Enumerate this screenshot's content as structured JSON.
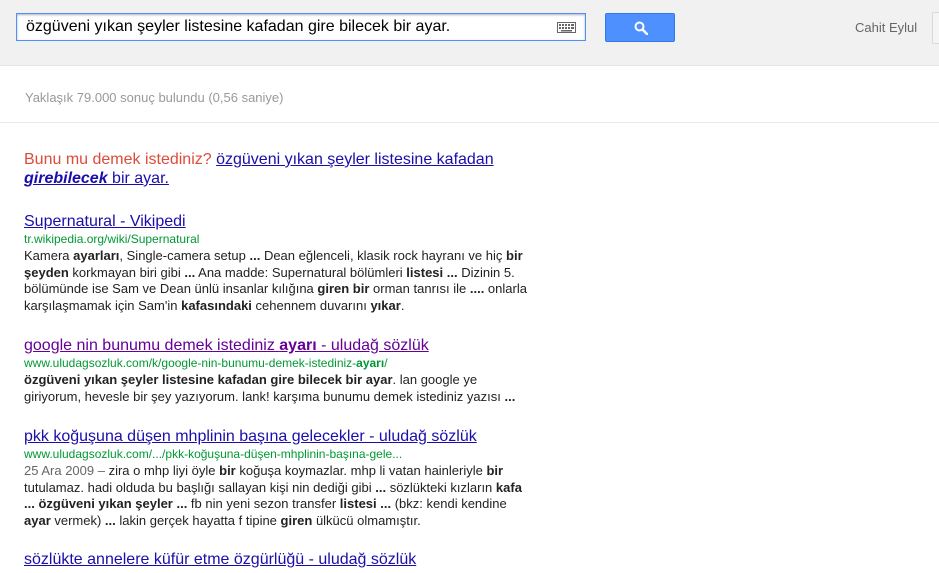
{
  "search": {
    "query": "özgüveni yıkan şeyler listesine kafadan gire bilecek bir ayar."
  },
  "header": {
    "user_name": "Cahit Eylul"
  },
  "stats": {
    "text": "Yaklaşık 79.000 sonuç bulundu (0,56 saniye)"
  },
  "spell": {
    "label": "Bunu mu demek istediniz?",
    "suggestion_parts": [
      {
        "t": "özgüveni yıkan şeyler listesine kafadan ",
        "em": false
      },
      {
        "t": "girebilecek",
        "em": true
      },
      {
        "t": " bir ayar.",
        "em": false
      }
    ]
  },
  "results": [
    {
      "title_parts": [
        {
          "t": "Supernatural - Vikipedi",
          "b": false
        }
      ],
      "visited": false,
      "url_parts": [
        {
          "t": "tr.wikipedia.org/wiki/Supernatural",
          "b": false
        }
      ],
      "date": "",
      "snippet_parts": [
        {
          "t": "Kamera ",
          "b": false
        },
        {
          "t": "ayarları",
          "b": true
        },
        {
          "t": ", Single-camera setup ",
          "b": false
        },
        {
          "t": "...",
          "b": true
        },
        {
          "t": " Dean eğlenceli, klasik rock hayranı ve hiç ",
          "b": false
        },
        {
          "t": "bir şeyden",
          "b": true
        },
        {
          "t": " korkmayan biri gibi ",
          "b": false
        },
        {
          "t": "...",
          "b": true
        },
        {
          "t": " Ana madde: Supernatural bölümleri ",
          "b": false
        },
        {
          "t": "listesi",
          "b": true
        },
        {
          "t": " ",
          "b": false
        },
        {
          "t": "...",
          "b": true
        },
        {
          "t": " Dizinin 5. bölümünde ise Sam ve Dean ünlü insanlar kılığına ",
          "b": false
        },
        {
          "t": "giren bir",
          "b": true
        },
        {
          "t": " orman tanrısı ile ",
          "b": false
        },
        {
          "t": "....",
          "b": true
        },
        {
          "t": " onlarla karşılaşmamak için Sam'in ",
          "b": false
        },
        {
          "t": "kafasındaki",
          "b": true
        },
        {
          "t": " cehennem duvarını ",
          "b": false
        },
        {
          "t": "yıkar",
          "b": true
        },
        {
          "t": ".",
          "b": false
        }
      ]
    },
    {
      "title_parts": [
        {
          "t": "google nin bunumu demek istediniz ",
          "b": false
        },
        {
          "t": "ayarı",
          "b": true
        },
        {
          "t": " - uludağ sözlük",
          "b": false
        }
      ],
      "visited": true,
      "url_parts": [
        {
          "t": "www.uludagsozluk.com/k/google-nin-bunumu-demek-istediniz-",
          "b": false
        },
        {
          "t": "ayarı",
          "b": true
        },
        {
          "t": "/",
          "b": false
        }
      ],
      "date": "",
      "snippet_parts": [
        {
          "t": "özgüveni yıkan şeyler listesine kafadan gire bilecek bir ayar",
          "b": true
        },
        {
          "t": ". lan google ye giriyorum, hevesle bir şey yazıyorum. lank! karşıma bunumu demek istediniz yazısı ",
          "b": false
        },
        {
          "t": "...",
          "b": true
        }
      ]
    },
    {
      "title_parts": [
        {
          "t": "pkk koğuşuna düşen mhplinin başına gelecekler - uludağ sözlük",
          "b": false
        }
      ],
      "visited": false,
      "url_parts": [
        {
          "t": "www.uludagsozluk.com/.../pkk-koğuşuna-düşen-mhplinin-başına-gele...",
          "b": false
        }
      ],
      "date": "25 Ara 2009 – ",
      "snippet_parts": [
        {
          "t": "zira o mhp liyi öyle ",
          "b": false
        },
        {
          "t": "bir",
          "b": true
        },
        {
          "t": " koğuşa koymazlar. mhp li vatan hainleriyle ",
          "b": false
        },
        {
          "t": "bir",
          "b": true
        },
        {
          "t": " tutulamaz. hadi olduda bu başlığı sallayan kişi nin dediği gibi ",
          "b": false
        },
        {
          "t": "...",
          "b": true
        },
        {
          "t": " sözlükteki kızların ",
          "b": false
        },
        {
          "t": "kafa ...",
          "b": true
        },
        {
          "t": " ",
          "b": false
        },
        {
          "t": "özgüveni yıkan şeyler ...",
          "b": true
        },
        {
          "t": " fb nin yeni sezon transfer ",
          "b": false
        },
        {
          "t": "listesi ...",
          "b": true
        },
        {
          "t": " (bkz: kendi kendine ",
          "b": false
        },
        {
          "t": "ayar",
          "b": true
        },
        {
          "t": " vermek) ",
          "b": false
        },
        {
          "t": "...",
          "b": true
        },
        {
          "t": " lakin gerçek hayatta f tipine ",
          "b": false
        },
        {
          "t": "giren",
          "b": true
        },
        {
          "t": " ülkücü olmamıştır.",
          "b": false
        }
      ]
    },
    {
      "title_parts": [
        {
          "t": "sözlükte annelere küfür etme özgürlüğü - uludağ sözlük",
          "b": false
        }
      ],
      "visited": false,
      "url_parts": [],
      "date": "",
      "snippet_parts": []
    }
  ],
  "colors": {
    "link": "#1a0dab",
    "visited_link": "#660099",
    "url_green": "#009933",
    "spell_red": "#dd4b39",
    "search_button_blue": "#4d90fe"
  },
  "icons": {
    "keyboard": "keyboard-icon",
    "search": "search-icon"
  }
}
